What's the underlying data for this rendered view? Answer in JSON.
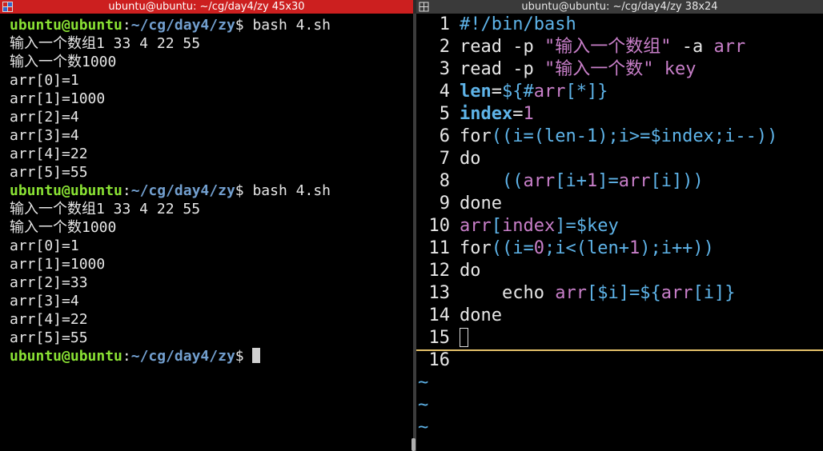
{
  "left_window": {
    "title": "ubuntu@ubuntu: ~/cg/day4/zy 45x30",
    "prompt": {
      "user_host": "ubuntu@ubuntu",
      "colon": ":",
      "path": "~/cg/day4/zy",
      "dollar": "$"
    },
    "lines": [
      {
        "type": "cmd",
        "text": " bash 4.sh"
      },
      {
        "type": "out",
        "text": "输入一个数组1 33 4 22 55"
      },
      {
        "type": "out",
        "text": "输入一个数1000"
      },
      {
        "type": "out",
        "text": "arr[0]=1"
      },
      {
        "type": "out",
        "text": "arr[1]=1000"
      },
      {
        "type": "out",
        "text": "arr[2]=4"
      },
      {
        "type": "out",
        "text": "arr[3]=4"
      },
      {
        "type": "out",
        "text": "arr[4]=22"
      },
      {
        "type": "out",
        "text": "arr[5]=55"
      },
      {
        "type": "cmd",
        "text": " bash 4.sh"
      },
      {
        "type": "out",
        "text": "输入一个数组1 33 4 22 55"
      },
      {
        "type": "out",
        "text": "输入一个数1000"
      },
      {
        "type": "out",
        "text": "arr[0]=1"
      },
      {
        "type": "out",
        "text": "arr[1]=1000"
      },
      {
        "type": "out",
        "text": "arr[2]=33"
      },
      {
        "type": "out",
        "text": "arr[3]=4"
      },
      {
        "type": "out",
        "text": "arr[4]=22"
      },
      {
        "type": "out",
        "text": "arr[5]=55"
      },
      {
        "type": "cursor",
        "text": " "
      }
    ]
  },
  "right_window": {
    "title": "ubuntu@ubuntu: ~/cg/day4/zy 38x24",
    "lines": [
      {
        "n": "1",
        "parts": [
          [
            "cm",
            "#!/bin/bash"
          ]
        ]
      },
      {
        "n": "2",
        "parts": [
          [
            "kw",
            "read -p "
          ],
          [
            "str",
            "\"输入一个数组\""
          ],
          [
            "kw",
            " -a "
          ],
          [
            "var",
            "arr"
          ]
        ]
      },
      {
        "n": "3",
        "parts": [
          [
            "kw",
            "read -p "
          ],
          [
            "str",
            "\"输入一个数\""
          ],
          [
            "kw",
            " "
          ],
          [
            "var",
            "key"
          ]
        ]
      },
      {
        "n": "4",
        "parts": [
          [
            "id",
            "len"
          ],
          [
            "op",
            "="
          ],
          [
            "ex",
            "${#"
          ],
          [
            "var",
            "arr"
          ],
          [
            "ex",
            "[*]}"
          ]
        ]
      },
      {
        "n": "5",
        "parts": [
          [
            "id",
            "index"
          ],
          [
            "op",
            "="
          ],
          [
            "num",
            "1"
          ]
        ]
      },
      {
        "n": "6",
        "parts": [
          [
            "kw",
            "for"
          ],
          [
            "ex",
            "((i=(len-1);i>="
          ],
          [
            "ex",
            "$index"
          ],
          [
            "ex",
            ";i--))"
          ]
        ]
      },
      {
        "n": "7",
        "parts": [
          [
            "kw",
            "do"
          ]
        ]
      },
      {
        "n": "8",
        "parts": [
          [
            "plain",
            "    "
          ],
          [
            "ex",
            "(("
          ],
          [
            "var",
            "arr"
          ],
          [
            "ex",
            "[i+"
          ],
          [
            "num",
            "1"
          ],
          [
            "ex",
            "]="
          ],
          [
            "var",
            "arr"
          ],
          [
            "ex",
            "[i]))"
          ]
        ]
      },
      {
        "n": "9",
        "parts": [
          [
            "kw",
            "done"
          ]
        ]
      },
      {
        "n": "10",
        "parts": [
          [
            "var",
            "arr"
          ],
          [
            "ex",
            "["
          ],
          [
            "var",
            "index"
          ],
          [
            "ex",
            "]="
          ],
          [
            "ex",
            "$key"
          ]
        ]
      },
      {
        "n": "11",
        "parts": [
          [
            "kw",
            "for"
          ],
          [
            "ex",
            "((i="
          ],
          [
            "num",
            "0"
          ],
          [
            "ex",
            ";i<(len+"
          ],
          [
            "num",
            "1"
          ],
          [
            "ex",
            ");i++))"
          ]
        ]
      },
      {
        "n": "12",
        "parts": [
          [
            "kw",
            "do"
          ]
        ]
      },
      {
        "n": "13",
        "parts": [
          [
            "plain",
            "    "
          ],
          [
            "kw",
            "echo "
          ],
          [
            "var",
            "arr"
          ],
          [
            "ex",
            "["
          ],
          [
            "ex",
            "$i"
          ],
          [
            "ex",
            "]="
          ],
          [
            "ex",
            "${"
          ],
          [
            "var",
            "arr"
          ],
          [
            "ex",
            "[i]}"
          ]
        ]
      },
      {
        "n": "14",
        "parts": [
          [
            "kw",
            "done"
          ]
        ]
      },
      {
        "n": "15",
        "parts": [],
        "current": true
      },
      {
        "n": "16",
        "parts": []
      }
    ],
    "tildes": [
      "~",
      "~",
      "~"
    ]
  }
}
